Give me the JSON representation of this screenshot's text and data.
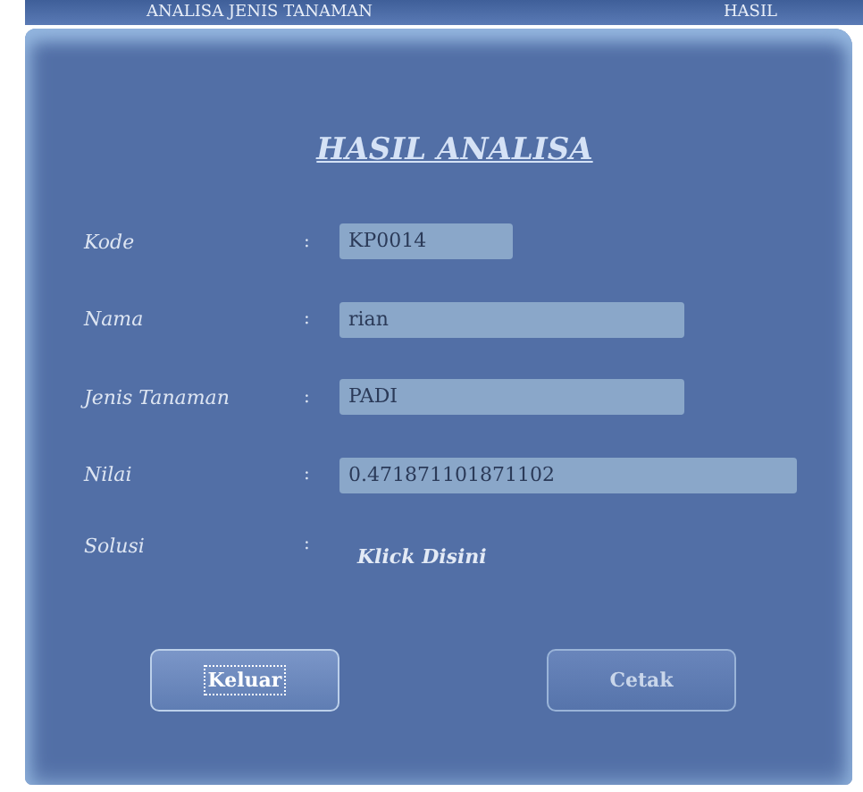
{
  "tabs": [
    {
      "label": "ANALISA JENIS TANAMAN"
    },
    {
      "label": "HASIL"
    }
  ],
  "title": "HASIL ANALISA",
  "fields": [
    {
      "label": "Kode",
      "value": "KP0014"
    },
    {
      "label": "Nama",
      "value": "rian"
    },
    {
      "label": "Jenis Tanaman",
      "value": "PADI"
    },
    {
      "label": "Nilai",
      "value": "0.471871101871102"
    }
  ],
  "solusi": {
    "label": "Solusi",
    "link": "Klick Disini"
  },
  "colon": ":",
  "buttons": [
    {
      "label": "Keluar",
      "focused": true
    },
    {
      "label": "Cetak",
      "focused": false
    }
  ]
}
